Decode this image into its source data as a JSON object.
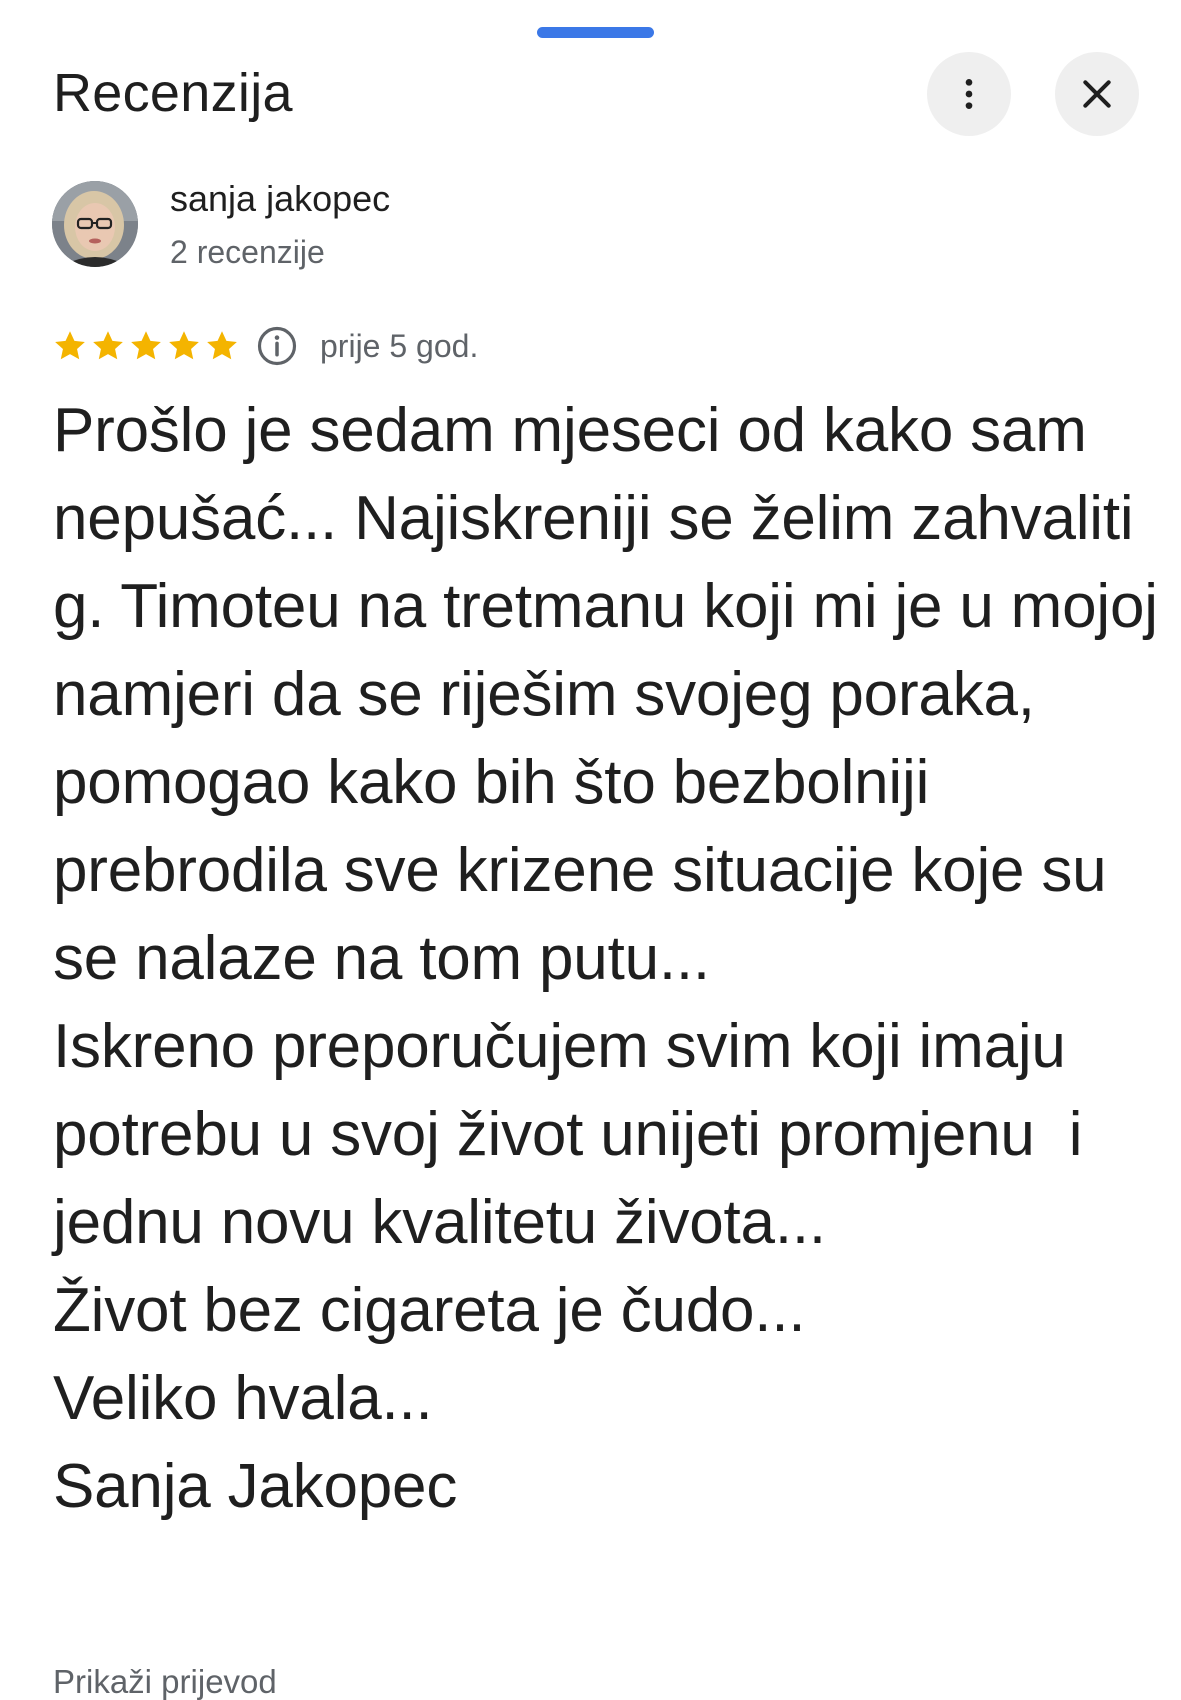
{
  "header": {
    "title": "Recenzija",
    "more_icon": "more-vert-icon",
    "close_icon": "close-icon"
  },
  "reviewer": {
    "name": "sanja jakopec",
    "review_count": "2 recenzije"
  },
  "review": {
    "rating": 5,
    "max_rating": 5,
    "time_ago": "prije 5 god.",
    "text": "Prošlo je sedam mjeseci od kako sam nepušać... Najiskreniji se želim zahvaliti g. Timoteu na tretmanu koji mi je u mojoj namjeri da se riješim svojeg poraka, pomogao kako bih što bezbolniji prebrodila sve krizene situacije koje su se nalaze na tom putu...\nIskreno preporučujem svim koji imaju potrebu u svoj život unijeti promjenu  i jednu novu kvalitetu života...\nŽivot bez cigareta je čudo...\nVeliko hvala...\nSanja Jakopec",
    "translate_label": "Prikaži prijevod"
  },
  "colors": {
    "accent": "#3b78e7",
    "star": "#f4b400",
    "text_primary": "#1f1f1f",
    "text_secondary": "#5f6368",
    "button_bg": "#efefef"
  }
}
